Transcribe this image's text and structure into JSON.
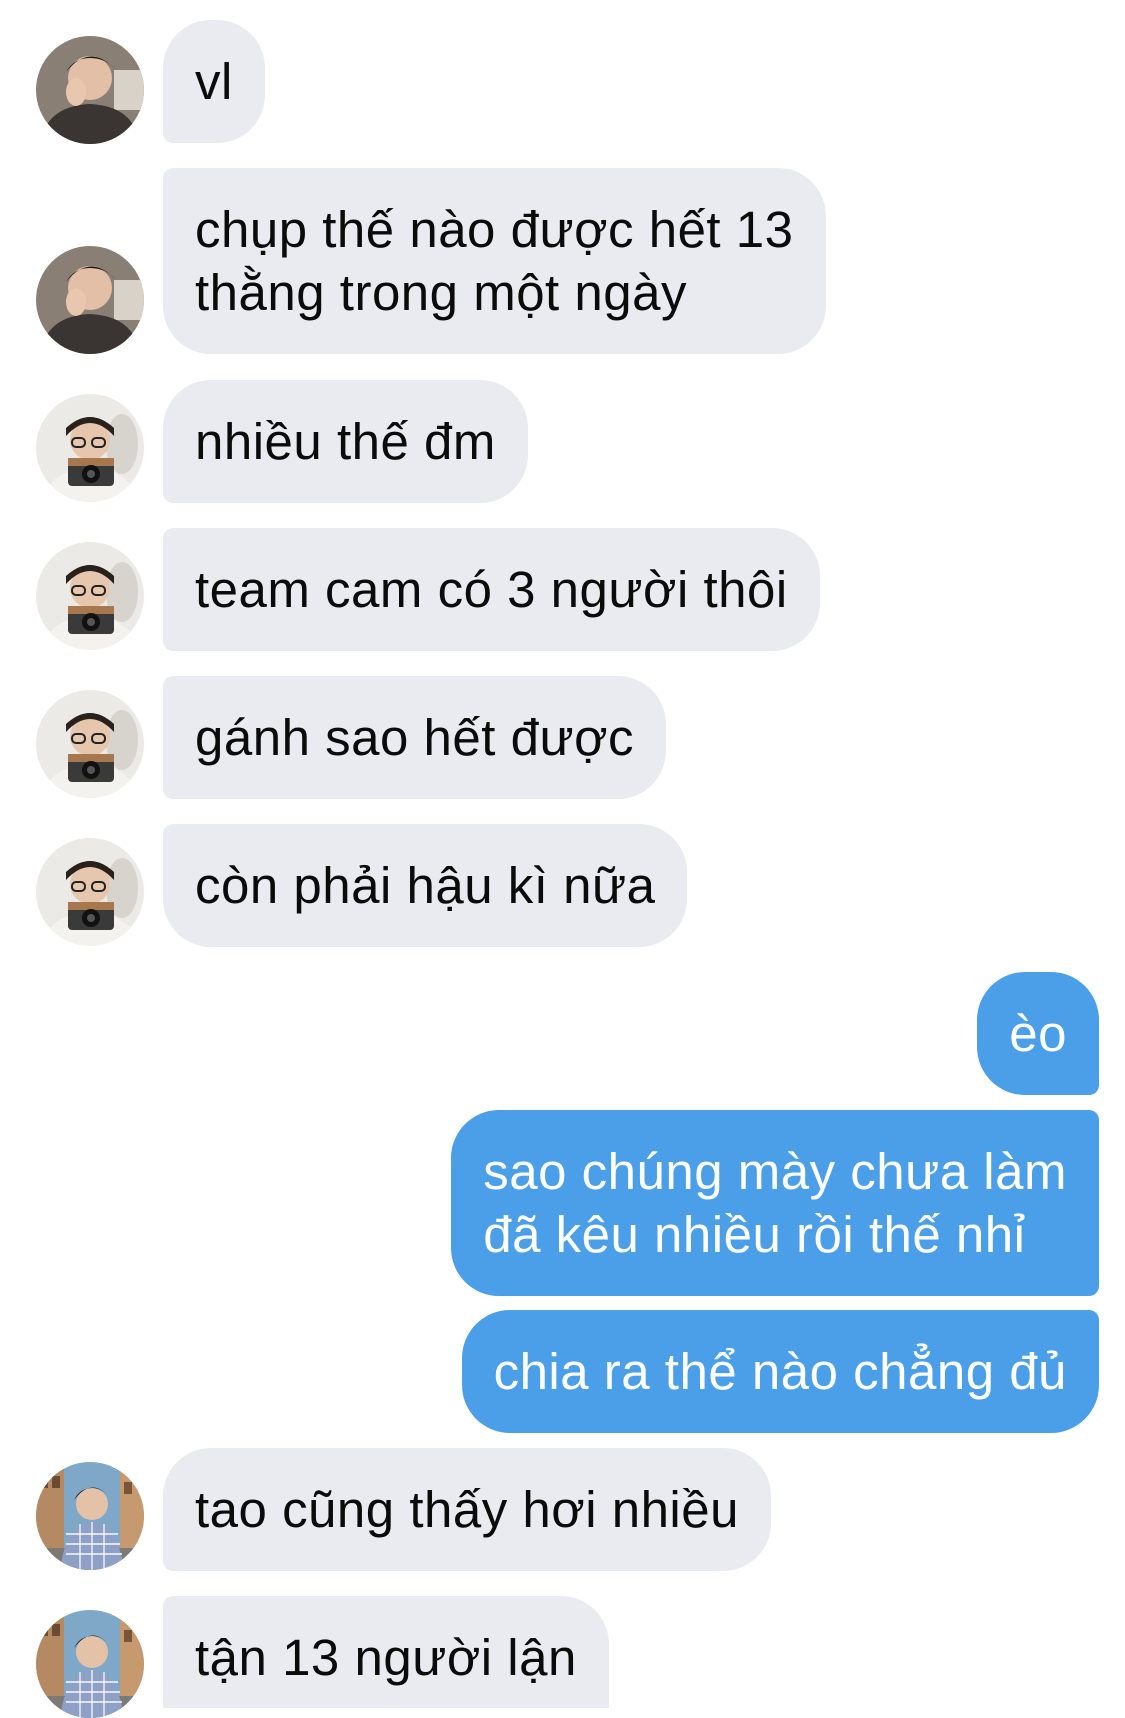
{
  "colors": {
    "incoming_bubble": "#e9ebf0",
    "outgoing_bubble": "#4b9fe9",
    "incoming_text": "#0b0b0b",
    "outgoing_text": "#ffffff"
  },
  "messages": [
    {
      "sender": "contact-1",
      "text": "vl"
    },
    {
      "sender": "contact-1",
      "text": "chụp thế nào được hết 13"
    },
    {
      "sender": "contact-1",
      "text": "thằng trong một ngày"
    },
    {
      "sender": "contact-2",
      "text": "nhiều thế đm"
    },
    {
      "sender": "contact-2",
      "text": "team cam có 3 người thôi"
    },
    {
      "sender": "contact-2",
      "text": "gánh sao hết được"
    },
    {
      "sender": "contact-2",
      "text": "còn phải hậu kì nữa"
    },
    {
      "sender": "me",
      "text": "èo"
    },
    {
      "sender": "me",
      "text": "sao chúng mày chưa làm"
    },
    {
      "sender": "me",
      "text": "đã kêu nhiều rồi thế nhỉ"
    },
    {
      "sender": "me",
      "text": "chia ra thể nào chẳng đủ"
    },
    {
      "sender": "contact-3",
      "text": "tao cũng thấy hơi nhiều"
    },
    {
      "sender": "contact-3",
      "text": "tận 13 người lận"
    }
  ]
}
